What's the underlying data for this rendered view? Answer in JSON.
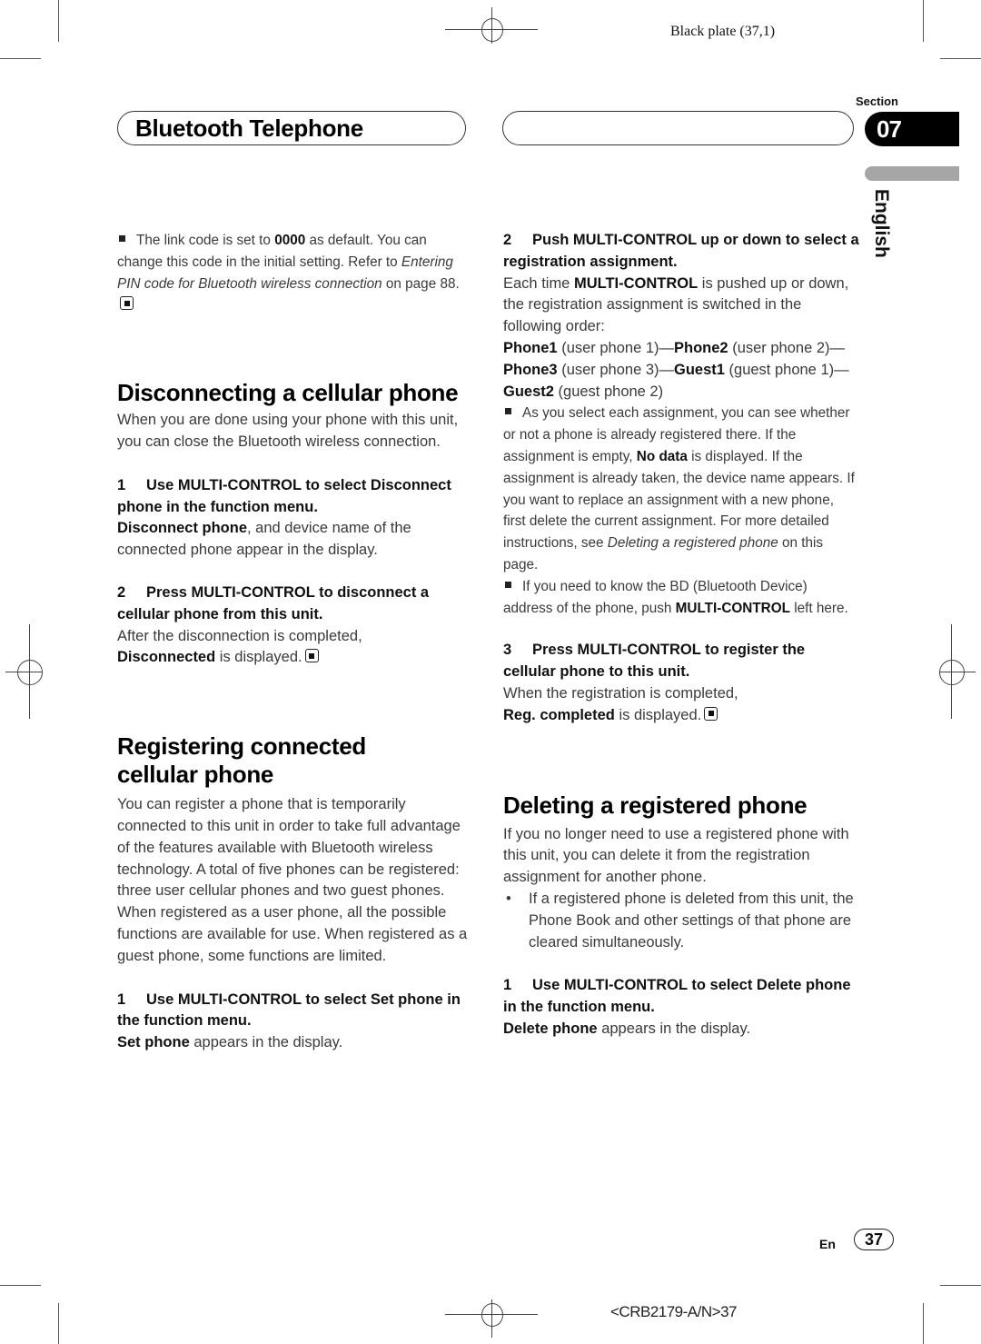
{
  "print_marks": {
    "plate_label": "Black plate (37,1)",
    "job_code": "<CRB2179-A/N>37"
  },
  "header": {
    "chapter_title": "Bluetooth Telephone",
    "section_label": "Section",
    "section_number": "07",
    "language": "English"
  },
  "left_column": {
    "intro_note": {
      "prefix": "The link code is set to ",
      "code": "0000",
      "middle": " as default. You can change this code in the initial setting. Refer to ",
      "link": "Entering PIN code for Bluetooth wireless connection",
      "suffix": " on page 88."
    },
    "disconnect_section": {
      "heading": "Disconnecting a cellular phone",
      "intro": "When you are done using your phone with this unit, you can close the Bluetooth wireless connection.",
      "step1": {
        "number": "1",
        "instruction": "Use MULTI-CONTROL to select Disconnect phone in the function menu.",
        "result_bold": "Disconnect phone",
        "result_text": ", and device name of the connected phone appear in the display."
      },
      "step2": {
        "number": "2",
        "instruction": "Press MULTI-CONTROL to disconnect a cellular phone from this unit.",
        "result_text": "After the disconnection is completed,",
        "result_bold": "Disconnected",
        "result_suffix": " is displayed."
      }
    },
    "register_section": {
      "heading": "Registering connected cellular phone",
      "intro": "You can register a phone that is temporarily connected to this unit in order to take full advantage of the features available with Bluetooth wireless technology. A total of five phones can be registered: three user cellular phones and two guest phones. When registered as a user phone, all the possible functions are available for use. When registered as a guest phone, some functions are limited.",
      "step1": {
        "number": "1",
        "instruction": "Use MULTI-CONTROL to select Set phone in the function menu.",
        "result_bold": "Set phone",
        "result_text": " appears in the display."
      }
    }
  },
  "right_column": {
    "step2": {
      "number": "2",
      "instruction": "Push MULTI-CONTROL up or down to select a registration assignment.",
      "text_prefix": "Each time ",
      "text_bold": "MULTI-CONTROL",
      "text_suffix": " is pushed up or down, the registration assignment is switched in the following order:",
      "order": [
        {
          "name": "Phone1",
          "desc": " (user phone 1)"
        },
        {
          "name": "Phone2",
          "desc": " (user phone 2)"
        },
        {
          "name": "Phone3",
          "desc": " (user phone 3)"
        },
        {
          "name": "Guest1",
          "desc": " (guest phone 1)"
        },
        {
          "name": "Guest2",
          "desc": " (guest phone 2)"
        }
      ],
      "separator": "—",
      "note1": {
        "prefix": "As you select each assignment, you can see whether or not a phone is already registered there. If the assignment is empty, ",
        "bold": "No data",
        "middle": " is displayed. If the assignment is already taken, the device name appears. If you want to replace an assignment with a new phone, first delete the current assignment. For more detailed instructions, see ",
        "link": "Deleting a registered phone",
        "suffix": " on this page."
      },
      "note2": {
        "prefix": "If you need to know the BD (Bluetooth Device) address of the phone, push ",
        "bold": "MULTI-CONTROL",
        "suffix": " left here."
      }
    },
    "step3": {
      "number": "3",
      "instruction": "Press MULTI-CONTROL to register the cellular phone to this unit.",
      "result_text": "When the registration is completed,",
      "result_bold": "Reg. completed",
      "result_suffix": " is displayed."
    },
    "delete_section": {
      "heading": "Deleting a registered phone",
      "intro": "If you no longer need to use a registered phone with this unit, you can delete it from the registration assignment for another phone.",
      "bullet": "If a registered phone is deleted from this unit, the Phone Book and other settings of that phone are cleared simultaneously.",
      "step1": {
        "number": "1",
        "instruction": "Use MULTI-CONTROL to select Delete phone in the function menu.",
        "result_bold": "Delete phone",
        "result_text": " appears in the display."
      }
    }
  },
  "footer": {
    "lang_code": "En",
    "page_number": "37"
  }
}
